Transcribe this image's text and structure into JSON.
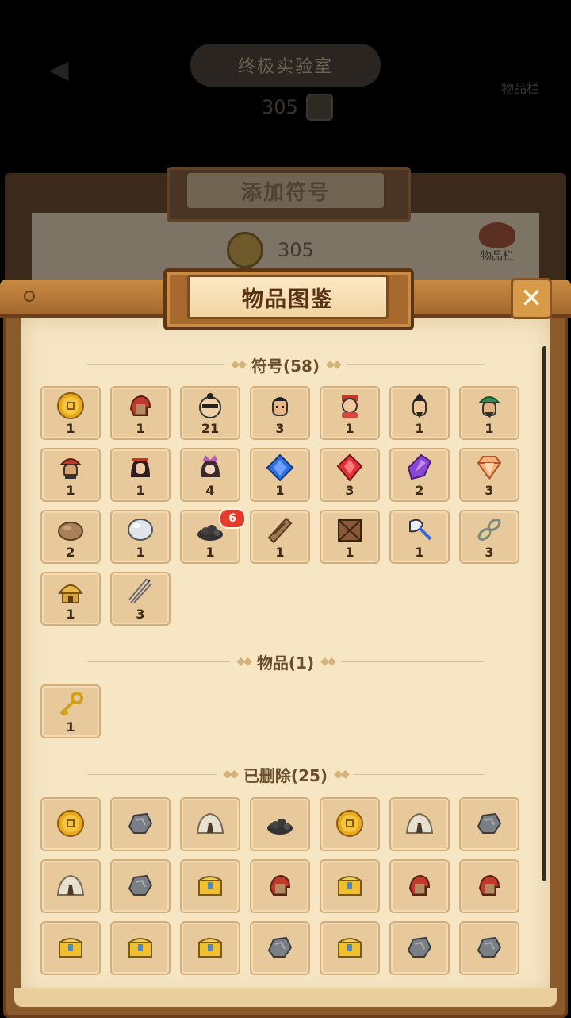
{
  "background": {
    "top_title": "终极实验室",
    "top_coins": "305",
    "right_label": "物品栏",
    "panel_title": "添加符号",
    "panel_coins": "305",
    "bag_label": "物品栏"
  },
  "dialog": {
    "title": "物品图鉴",
    "close_label": "✕"
  },
  "sections": {
    "symbols": "符号(58)",
    "items": "物品(1)",
    "deleted": "已删除(25)"
  },
  "symbols": [
    {
      "icon": "coin-icon",
      "count": "1"
    },
    {
      "icon": "warrior-helmet-icon",
      "count": "1"
    },
    {
      "icon": "bandit-face-icon",
      "count": "21"
    },
    {
      "icon": "soldier-face-icon",
      "count": "3"
    },
    {
      "icon": "fortune-god-icon",
      "count": "1"
    },
    {
      "icon": "scholar-face-icon",
      "count": "1"
    },
    {
      "icon": "general-green-icon",
      "count": "1"
    },
    {
      "icon": "general-red-icon",
      "count": "1"
    },
    {
      "icon": "warrior-woman-icon",
      "count": "1"
    },
    {
      "icon": "princess-icon",
      "count": "4"
    },
    {
      "icon": "sapphire-icon",
      "count": "1"
    },
    {
      "icon": "ruby-icon",
      "count": "3"
    },
    {
      "icon": "amethyst-icon",
      "count": "2"
    },
    {
      "icon": "diamond-icon",
      "count": "3"
    },
    {
      "icon": "rock-icon",
      "count": "2"
    },
    {
      "icon": "pearl-icon",
      "count": "1"
    },
    {
      "icon": "coal-icon",
      "count": "1"
    },
    {
      "icon": "scroll-icon",
      "count": "1"
    },
    {
      "icon": "crate-icon",
      "count": "1"
    },
    {
      "icon": "axe-icon",
      "count": "1"
    },
    {
      "icon": "chain-icon",
      "count": "3"
    },
    {
      "icon": "hut-icon",
      "count": "1"
    },
    {
      "icon": "arrows-icon",
      "count": "3"
    }
  ],
  "coal_badge": "6",
  "items": [
    {
      "icon": "key-icon",
      "count": "1"
    }
  ],
  "deleted": [
    "coin-icon",
    "ore-icon",
    "tent-icon",
    "coal-icon",
    "coin-icon",
    "tent-icon",
    "ore-icon",
    "tent-icon",
    "ore-icon",
    "chest-icon",
    "warrior-helmet-icon",
    "chest-icon",
    "warrior-helmet-icon",
    "warrior-helmet-icon",
    "chest-icon",
    "chest-icon",
    "chest-icon",
    "ore-icon",
    "chest-icon",
    "ore-icon",
    "ore-icon"
  ],
  "colors": {
    "paper": "#f6e6c4",
    "slot": "#e7c99b",
    "frame": "#8b5a2b",
    "badge": "#e53b2c"
  }
}
